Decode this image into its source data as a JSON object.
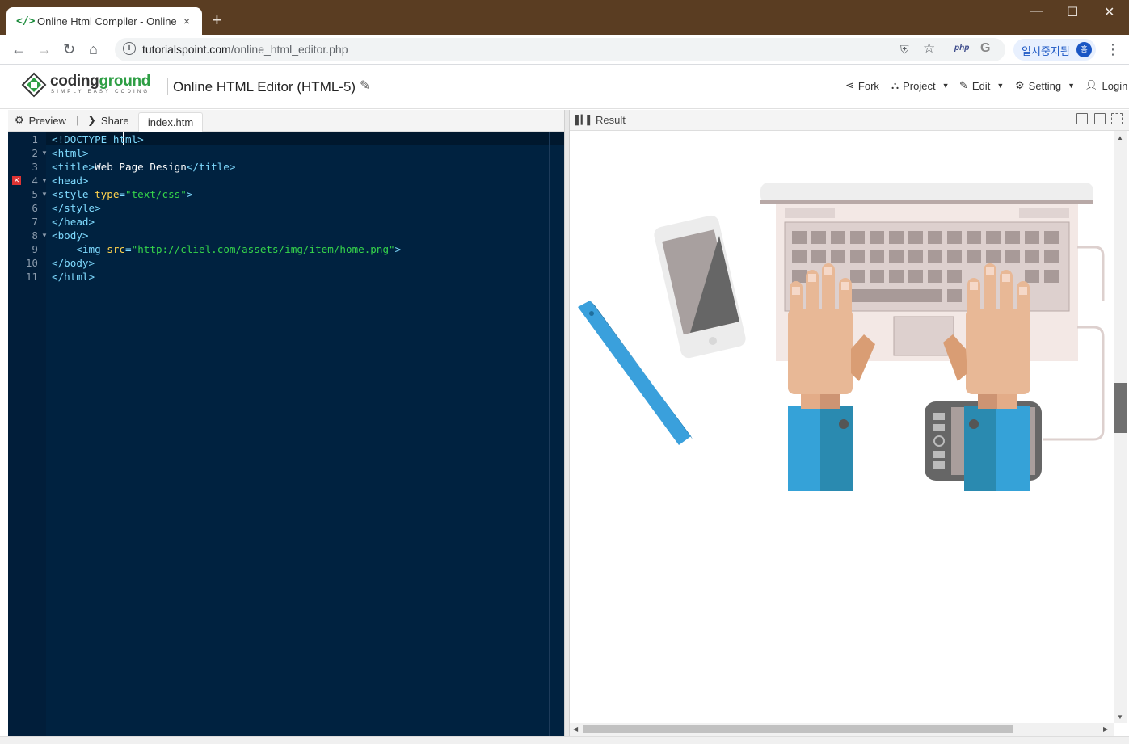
{
  "browser": {
    "tab_title": "Online Html Compiler - Online H",
    "tab_favicon": "</>",
    "tab_close": "×",
    "new_tab": "+",
    "window_min": "—",
    "window_max": "☐",
    "window_close": "✕",
    "url_domain": "tutorialspoint.com",
    "url_path": "/online_html_editor.php",
    "ext_php": "php",
    "ext_g": "G",
    "profile_label": "일시중지됨",
    "profile_avatar": "흠"
  },
  "site": {
    "logo_main": "coding",
    "logo_accent": "ground",
    "logo_tagline": "SIMPLY EASY CODING",
    "title": "Online HTML Editor (HTML-5)",
    "nav": {
      "fork": "Fork",
      "project": "Project",
      "edit": "Edit",
      "setting": "Setting",
      "login": "Login"
    }
  },
  "editor": {
    "preview_label": "Preview",
    "share_label": "Share",
    "file_tab": "index.htm",
    "line_numbers": [
      "1",
      "2",
      "3",
      "4",
      "5",
      "6",
      "7",
      "8",
      "9",
      "10",
      "11"
    ],
    "error_line": 4
  },
  "result": {
    "label": "Result",
    "image_description_icons": [
      "ruler-icon",
      "phone-icon",
      "laptop-icon",
      "hands-icon",
      "tablet-icon"
    ]
  },
  "colors": {
    "editor_bg": "#002240",
    "tag": "#7fdbff",
    "attribute": "#ffd34d",
    "string": "#35d44a",
    "brand_green": "#2e9e44",
    "titlebar": "#5a3d22"
  }
}
